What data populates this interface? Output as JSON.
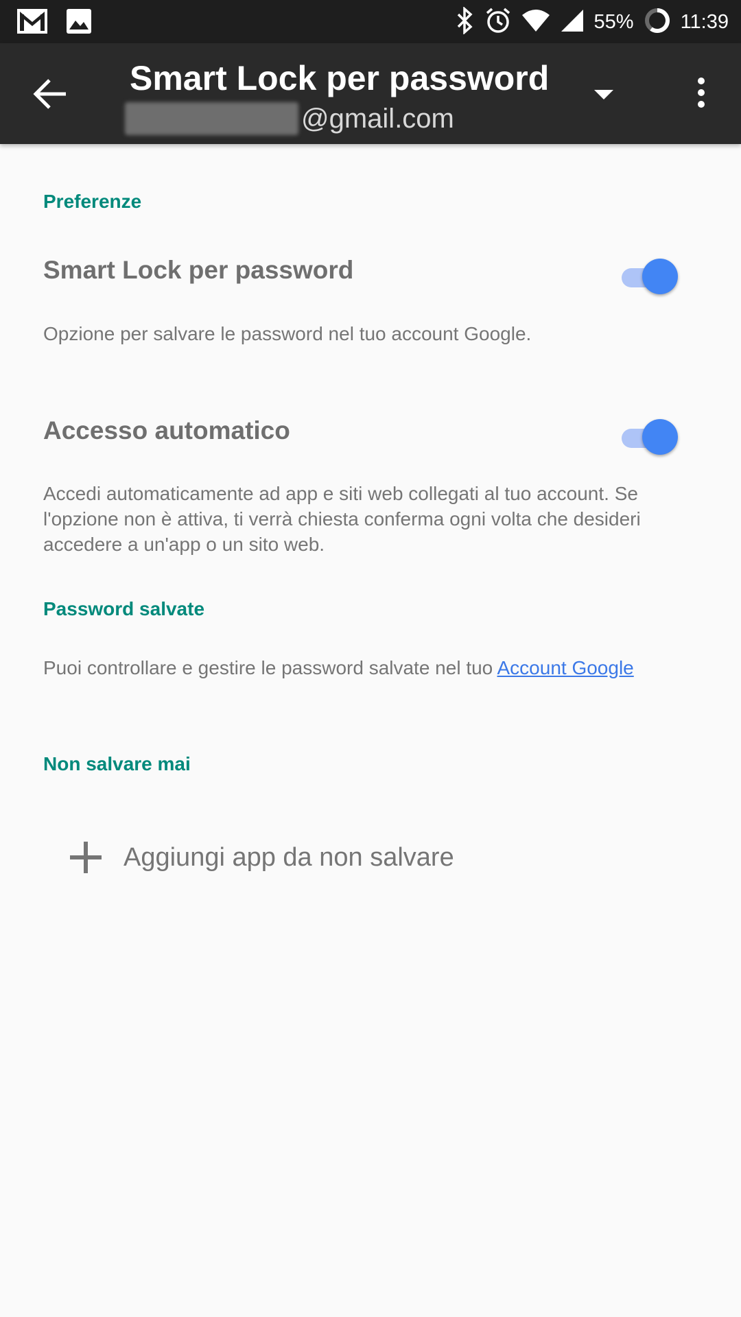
{
  "status_bar": {
    "battery": "55%",
    "time": "11:39",
    "icons": [
      "gmail-icon",
      "image-icon",
      "bluetooth-icon",
      "alarm-icon",
      "wifi-icon",
      "signal-icon",
      "battery-icon"
    ]
  },
  "app_bar": {
    "title": "Smart Lock per password",
    "account_domain": "@gmail.com",
    "icons": [
      "arrow-back-icon",
      "dropdown-icon",
      "more-vert-icon"
    ]
  },
  "sections": {
    "preferences": {
      "header": "Preferenze",
      "smart_lock": {
        "title": "Smart Lock per password",
        "description": "Opzione per salvare le password nel tuo account Google.",
        "enabled": true
      },
      "auto_signin": {
        "title": "Accesso automatico",
        "description": "Accedi automaticamente ad app e siti web collegati al tuo account. Se l'opzione non è attiva, ti verrà chiesta conferma ogni volta che desideri accedere a un'app o un sito web.",
        "enabled": true
      }
    },
    "saved_passwords": {
      "header": "Password salvate",
      "text": "Puoi controllare e gestire le password salvate nel tuo ",
      "link": "Account Google"
    },
    "never_save": {
      "header": "Non salvare mai",
      "add_label": "Aggiungi app da non salvare"
    }
  },
  "colors": {
    "accent": "#00897b",
    "toggle_thumb": "#4285f4",
    "toggle_track": "#aec4f7",
    "link": "#3b78e7",
    "app_bar": "#2a2a2a"
  }
}
